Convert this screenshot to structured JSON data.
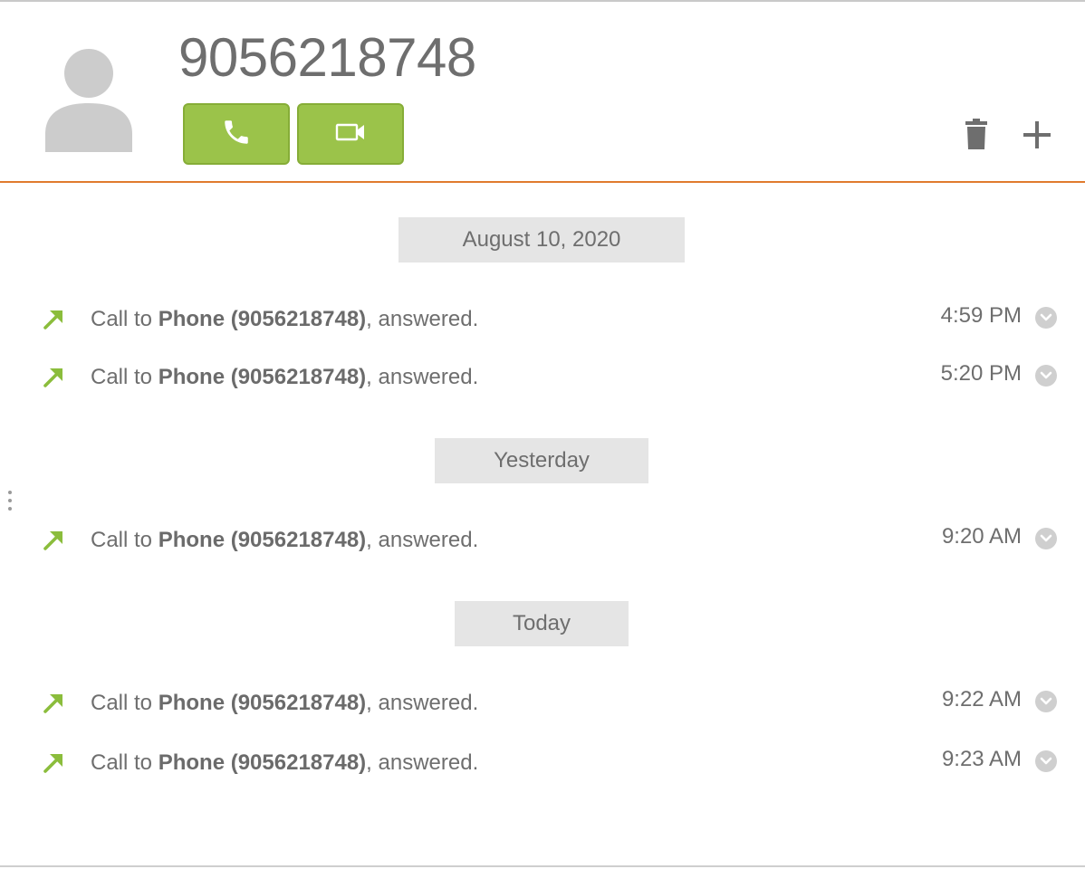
{
  "contact": {
    "number": "9056218748",
    "avatar_icon": "person-silhouette-icon"
  },
  "actions": {
    "call_icon": "phone-icon",
    "video_icon": "video-camera-icon",
    "delete_icon": "trash-icon",
    "add_icon": "plus-icon"
  },
  "colors": {
    "accent_green": "#9bc34a",
    "divider_orange": "#e07b2e",
    "date_header_bg": "#e5e5e5"
  },
  "history": {
    "groups": [
      {
        "date": "August 10, 2020",
        "entries": [
          {
            "prefix": "Call to ",
            "target": "Phone (9056218748)",
            "suffix": ", answered.",
            "time": "4:59 PM"
          },
          {
            "prefix": "Call to ",
            "target": "Phone (9056218748)",
            "suffix": ", answered.",
            "time": "5:20 PM"
          }
        ]
      },
      {
        "date": "Yesterday",
        "entries": [
          {
            "prefix": "Call to ",
            "target": "Phone (9056218748)",
            "suffix": ", answered.",
            "time": "9:20 AM"
          }
        ]
      },
      {
        "date": "Today",
        "entries": [
          {
            "prefix": "Call to ",
            "target": "Phone (9056218748)",
            "suffix": ", answered.",
            "time": "9:22 AM"
          },
          {
            "prefix": "Call to ",
            "target": "Phone (9056218748)",
            "suffix": ", answered.",
            "time": "9:23 AM"
          }
        ]
      }
    ],
    "entry_icon": "outgoing-call-arrow-icon",
    "expand_icon": "chevron-down-circle-icon"
  }
}
